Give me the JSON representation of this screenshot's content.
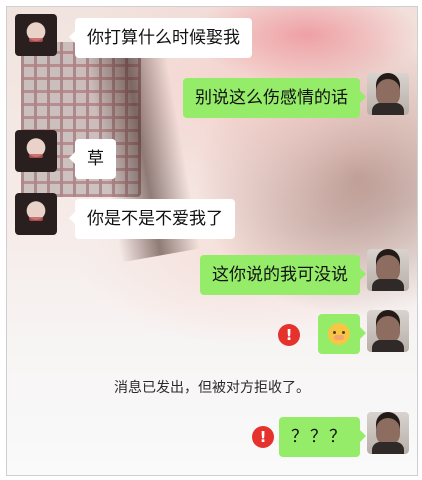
{
  "chat": {
    "messages": [
      {
        "sender": "her",
        "text": "你打算什么时候娶我"
      },
      {
        "sender": "me",
        "text": "别说这么伤感情的话"
      },
      {
        "sender": "her",
        "text": "草"
      },
      {
        "sender": "her",
        "text": "你是不是不爱我了"
      },
      {
        "sender": "me",
        "text": "这你说的我可没说"
      },
      {
        "sender": "me",
        "emoji": "blushing-smile-emoji",
        "failed": true
      },
      {
        "sender": "system",
        "text": "消息已发出，但被对方拒收了。"
      },
      {
        "sender": "me",
        "text": "？？？",
        "failed": true
      }
    ],
    "failed_icon_glyph": "!"
  },
  "colors": {
    "incoming_bubble": "#ffffff",
    "outgoing_bubble": "#95ec69",
    "error_badge": "#e5322d"
  }
}
